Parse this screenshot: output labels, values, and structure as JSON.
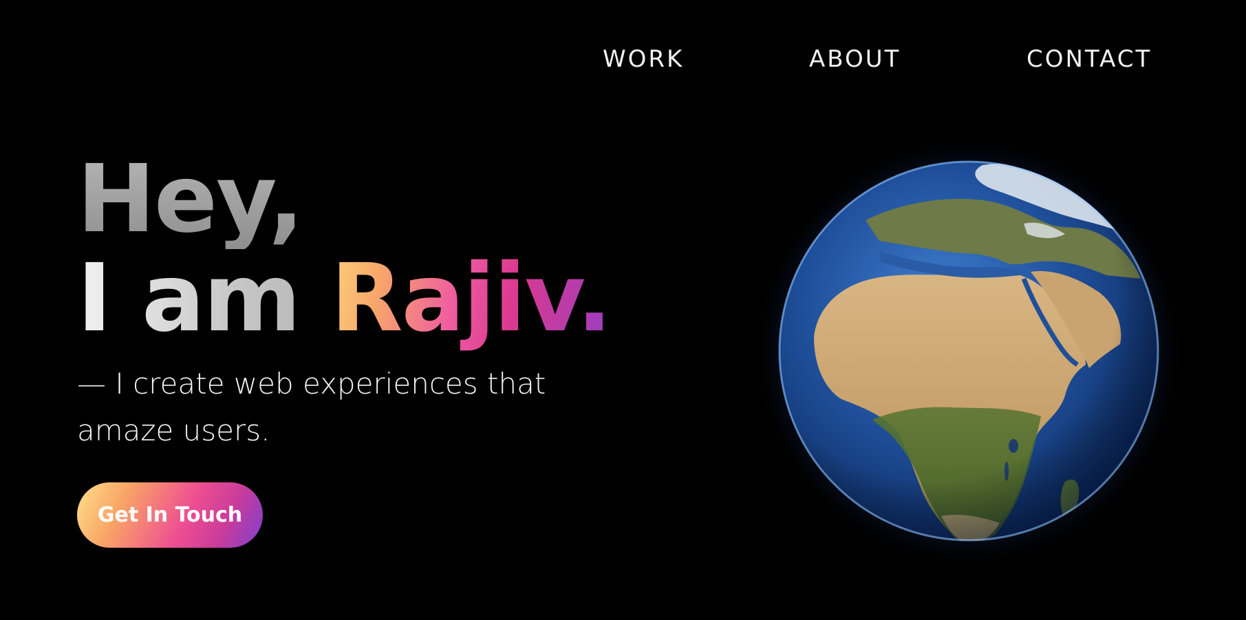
{
  "nav": {
    "work": "WORK",
    "about": "ABOUT",
    "contact": "CONTACT"
  },
  "hero": {
    "line1": "Hey,",
    "line2_prefix": "I am ",
    "name": "Rajiv.",
    "tagline": "— I create web experiences that amaze users.",
    "cta_label": "Get In Touch"
  },
  "colors": {
    "background": "#000000",
    "text": "#ffffff",
    "gradient_start": "#fde08a",
    "gradient_mid": "#ee4e91",
    "gradient_end": "#7d3fd0",
    "ocean": "#1f4f9a",
    "land_desert": "#c9a36b",
    "land_green": "#4f6d2e",
    "glow": "#6aa9ff"
  },
  "icons": {
    "globe": "earth-globe-icon"
  }
}
